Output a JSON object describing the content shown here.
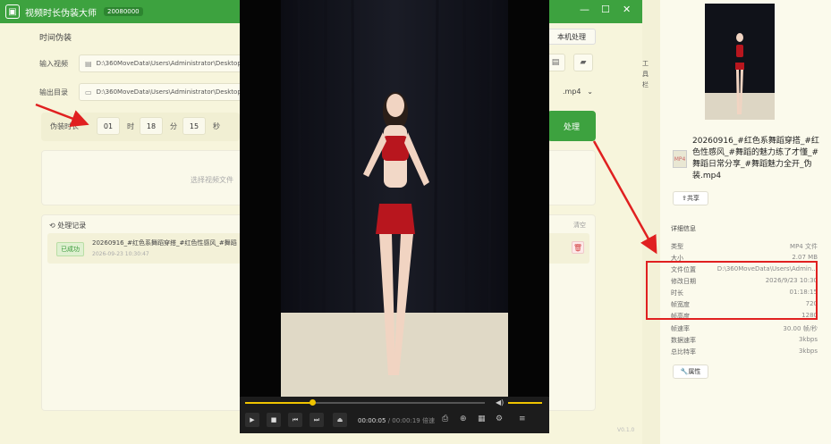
{
  "app": {
    "title": "视频时长伪装大师",
    "badge": "20080000",
    "version": "V0.1.0"
  },
  "section": {
    "title": "时间伪装",
    "local_button": "本机处理"
  },
  "input": {
    "label": "输入视频",
    "path": "D:\\360MoveData\\Users\\Administrator\\Desktop"
  },
  "output": {
    "label": "输出目录",
    "path": "D:\\360MoveData\\Users\\Administrator\\Desktop",
    "format": ".mp4"
  },
  "duration": {
    "label": "伪装时长",
    "hours": "01",
    "hours_unit": "时",
    "minutes": "18",
    "minutes_unit": "分",
    "seconds": "15",
    "seconds_unit": "秒"
  },
  "process_button": "处理",
  "drop_text": "选择视频文件",
  "history": {
    "title": "处理记录",
    "clear": "清空",
    "item": {
      "status": "已成功",
      "name": "20260916_#红色系舞蹈穿搭_#红色性感风_#舞蹈",
      "time": "2026-09-23 10:30:47"
    }
  },
  "player": {
    "current": "00:00:05",
    "sep": "/",
    "total": "00:00:19",
    "speed": "倍速",
    "progress": 0.28,
    "volume": 1.0
  },
  "side_strip": [
    "工",
    "具",
    "栏"
  ],
  "file": {
    "name": "20260916_#红色系舞蹈穿搭_#红色性感风_#舞蹈的魅力练了才懂_#舞蹈日常分享_#舞蹈魅力全开_伪装.mp4",
    "icon_text": "MP4",
    "share": "共享"
  },
  "details": {
    "title": "详细信息",
    "rows": [
      {
        "k": "类型",
        "v": "MP4 文件"
      },
      {
        "k": "大小",
        "v": "2.07 MB"
      },
      {
        "k": "文件位置",
        "v": "D:\\360MoveData\\Users\\Admin..."
      },
      {
        "k": "修改日期",
        "v": "2026/9/23 10:30"
      },
      {
        "k": "时长",
        "v": "01:18:15"
      },
      {
        "k": "帧宽度",
        "v": "720"
      },
      {
        "k": "帧高度",
        "v": "1280"
      },
      {
        "k": "帧速率",
        "v": "30.00 帧/秒"
      },
      {
        "k": "数据速率",
        "v": "3kbps"
      },
      {
        "k": "总比特率",
        "v": "3kbps"
      }
    ],
    "properties": "属性"
  },
  "colors": {
    "accent": "#3da23f",
    "annotation": "#e02020"
  }
}
